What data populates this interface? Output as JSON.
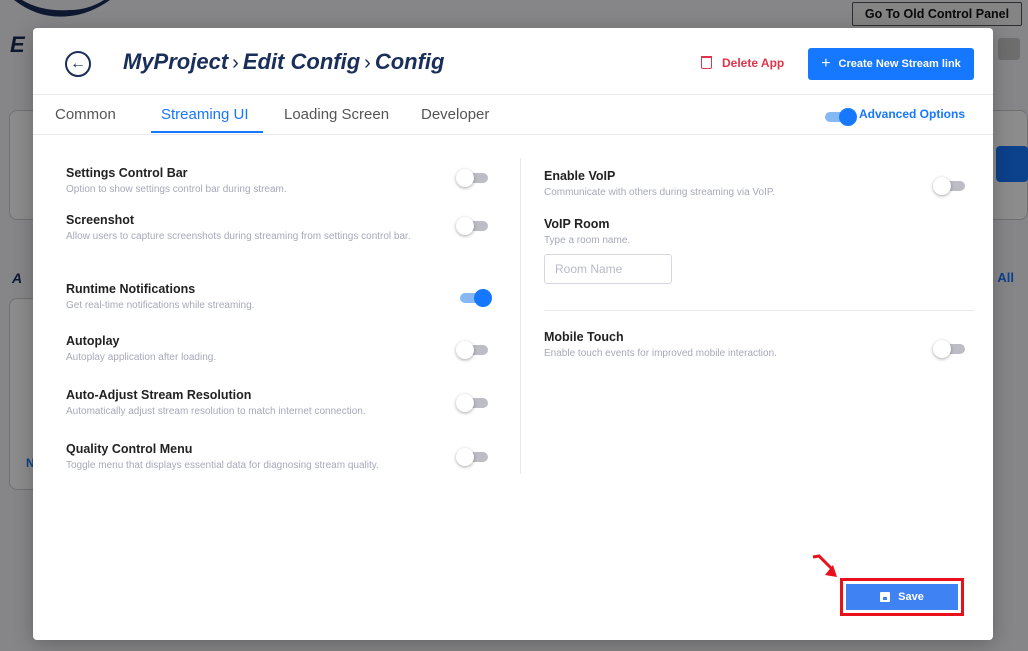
{
  "background": {
    "old_panel_label": "Go To Old Control Panel",
    "logo_text": "E",
    "section_letter": "A",
    "view_all": "All",
    "stray_letter": "N"
  },
  "header": {
    "project": "MyProject",
    "edit_config": "Edit Config",
    "config": "Config",
    "separator": "›",
    "delete_label": "Delete App",
    "create_label": "Create New Stream link"
  },
  "tabs": [
    "Common",
    "Streaming UI",
    "Loading Screen",
    "Developer"
  ],
  "active_tab": "Streaming UI",
  "advanced_options": {
    "label": "Advanced Options",
    "enabled": true
  },
  "left_settings": [
    {
      "label": "Settings Control Bar",
      "desc": "Option to show settings control bar during stream.",
      "enabled": false
    },
    {
      "label": "Screenshot",
      "desc": "Allow users to capture screenshots during streaming from settings control bar.",
      "enabled": false
    },
    {
      "label": "Runtime Notifications",
      "desc": "Get real-time notifications while streaming.",
      "enabled": true
    },
    {
      "label": "Autoplay",
      "desc": "Autoplay application after loading.",
      "enabled": false
    },
    {
      "label": "Auto-Adjust Stream Resolution",
      "desc": "Automatically adjust stream resolution to match internet connection.",
      "enabled": false
    },
    {
      "label": "Quality Control Menu",
      "desc": "Toggle menu that displays essential data for diagnosing stream quality.",
      "enabled": false
    }
  ],
  "right_settings": {
    "voip": {
      "label": "Enable VoIP",
      "desc": "Communicate with others during streaming via VoIP.",
      "enabled": false
    },
    "voip_room": {
      "label": "VoIP Room",
      "desc": "Type a room name.",
      "placeholder": "Room Name",
      "value": ""
    },
    "mobile_touch": {
      "label": "Mobile Touch",
      "desc": "Enable touch events for improved mobile interaction.",
      "enabled": false
    }
  },
  "footer": {
    "save_label": "Save"
  },
  "colors": {
    "accent": "#1677ff",
    "danger": "#e0344a",
    "title": "#1a2e5a",
    "highlight": "#e8101a"
  }
}
